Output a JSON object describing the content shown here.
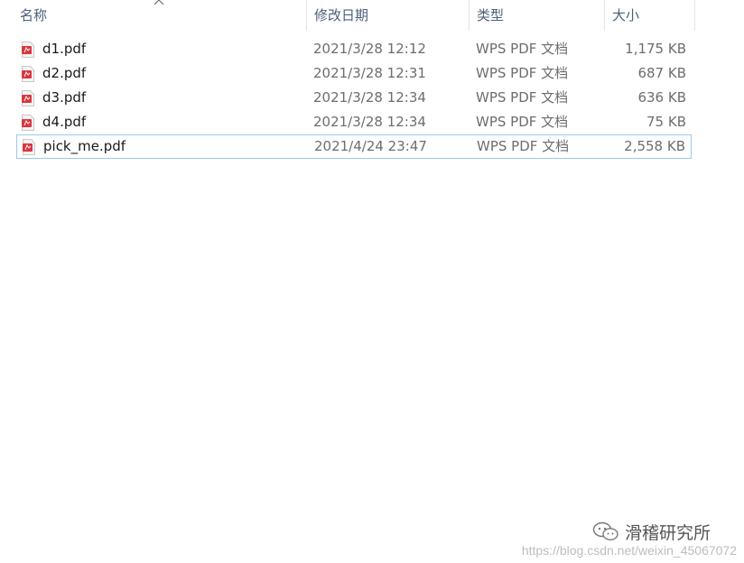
{
  "columns": {
    "name": "名称",
    "date": "修改日期",
    "type": "类型",
    "size": "大小"
  },
  "sort": {
    "column": "name",
    "direction": "ascending",
    "icon": "chevron-up-icon"
  },
  "files": [
    {
      "name": "d1.pdf",
      "date": "2021/3/28 12:12",
      "type": "WPS PDF 文档",
      "size": "1,175 KB",
      "icon": "pdf-file-icon",
      "selected": false
    },
    {
      "name": "d2.pdf",
      "date": "2021/3/28 12:31",
      "type": "WPS PDF 文档",
      "size": "687 KB",
      "icon": "pdf-file-icon",
      "selected": false
    },
    {
      "name": "d3.pdf",
      "date": "2021/3/28 12:34",
      "type": "WPS PDF 文档",
      "size": "636 KB",
      "icon": "pdf-file-icon",
      "selected": false
    },
    {
      "name": "d4.pdf",
      "date": "2021/3/28 12:34",
      "type": "WPS PDF 文档",
      "size": "75 KB",
      "icon": "pdf-file-icon",
      "selected": false
    },
    {
      "name": "pick_me.pdf",
      "date": "2021/4/24 23:47",
      "type": "WPS PDF 文档",
      "size": "2,558 KB",
      "icon": "pdf-file-icon",
      "selected": true
    }
  ],
  "watermark": {
    "brand": "滑稽研究所",
    "brand_icon": "wechat-icon",
    "url": "https://blog.csdn.net/weixin_45067072"
  },
  "colors": {
    "header_text": "#4c607a",
    "selection_border": "#99c9ef",
    "pdf_icon": "#d9363e"
  }
}
